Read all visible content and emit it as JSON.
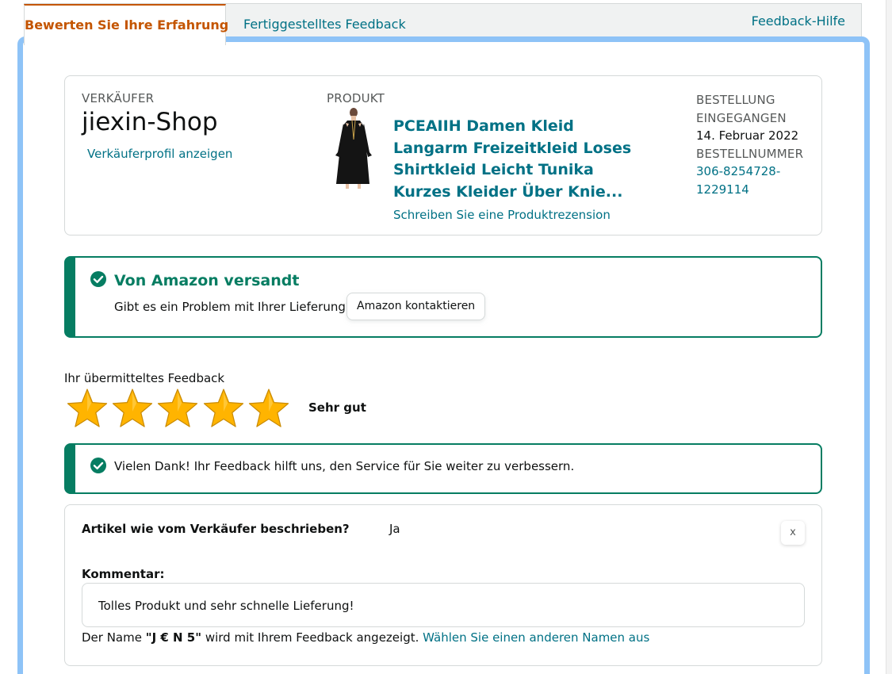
{
  "tabs": {
    "active_label": "Bewerten Sie Ihre Erfahrung",
    "completed_label": "Fertiggestelltes Feedback",
    "help_label": "Feedback-Hilfe"
  },
  "order": {
    "seller_label": "VERKÄUFER",
    "seller_name": "jiexin-Shop",
    "seller_profile_link": "Verkäuferprofil anzeigen",
    "product_label": "PRODUKT",
    "product_title": "PCEAIIH Damen Kleid Langarm Freizeitkleid Loses Shirtkleid Leicht Tunika Kurzes Kleider Über Knie...",
    "write_review_link": "Schreiben Sie eine Produktrezension",
    "order_received_label_1": "BESTELLUNG",
    "order_received_label_2": "EINGEGANGEN",
    "order_date": "14. Februar 2022",
    "order_number_label": "BESTELLNUMMER",
    "order_number_1": "306-8254728-",
    "order_number_2": "1229114"
  },
  "shipping_alert": {
    "title": "Von Amazon versandt",
    "question": "Gibt es ein Problem mit Ihrer Lieferung?",
    "contact_button": "Amazon kontaktieren"
  },
  "rating": {
    "label": "Ihr übermitteltes Feedback",
    "stars_filled": 5,
    "stars_total": 5,
    "text": "Sehr gut"
  },
  "thanks_alert": {
    "text": "Vielen Dank! Ihr Feedback hilft uns, den Service für Sie weiter zu verbessern."
  },
  "detail": {
    "question": "Artikel wie vom Verkäufer beschrieben?",
    "answer": "Ja",
    "close_label": "x",
    "comment_label": "Kommentar:",
    "comment_value": "Tolles Produkt und sehr schnelle Lieferung!",
    "name_prefix": "Der Name",
    "name_value": "\"J € N 5\"",
    "name_suffix": "wird mit Ihrem Feedback angezeigt.",
    "change_name_link": "Wählen Sie einen anderen Namen aus"
  },
  "colors": {
    "link": "#007185",
    "active_tab": "#c45500",
    "success": "#067d62",
    "highlight_border": "#8ec3f7",
    "star": "#ffb400"
  },
  "icons": [
    "check-circle-icon",
    "star-icon",
    "close-icon",
    "product-thumbnail"
  ]
}
